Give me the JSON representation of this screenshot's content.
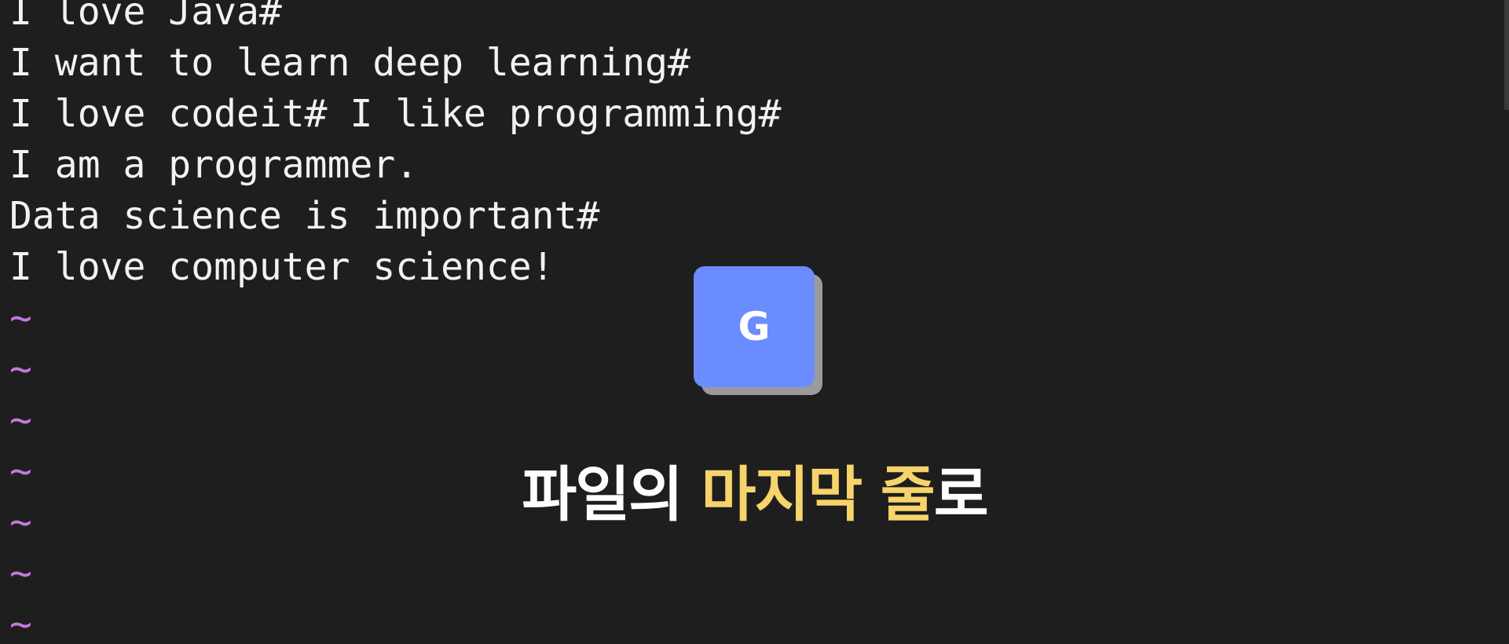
{
  "editor": {
    "lines": [
      "I love Java#",
      "I want to learn deep learning#",
      "I love codeit# I like programming#",
      "I am a programmer.",
      "Data science is important#",
      "I love computer science!"
    ],
    "empty_line_marker": "~",
    "empty_line_count": 7,
    "text_color": "#f2f2f2",
    "marker_color": "#c678dd",
    "background": "#1e1e1e"
  },
  "key_overlay": {
    "key": "G",
    "key_color": "#6b8cff",
    "shadow_color": "#9b9b9b"
  },
  "caption": {
    "part1": "파일의 ",
    "highlight": "마지막 줄",
    "part2": "로",
    "highlight_color": "#f7d46b"
  }
}
